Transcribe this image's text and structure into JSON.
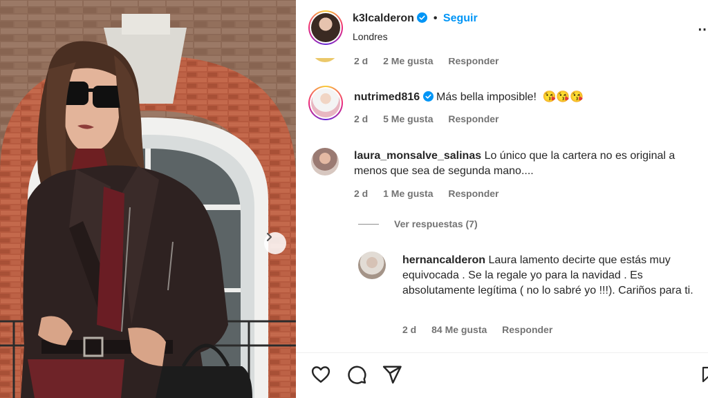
{
  "post": {
    "username": "k3lcalderon",
    "follow_label": "Seguir",
    "separator": "•",
    "location": "Londres",
    "more_label": "⋯"
  },
  "partial_comment": {
    "time": "2 d",
    "likes": "2 Me gusta",
    "reply": "Responder"
  },
  "comments": [
    {
      "username": "nutrimed816",
      "text": "Más bella imposible!",
      "emojis": "😘😘😘",
      "time": "2 d",
      "likes": "5 Me gusta",
      "reply": "Responder"
    },
    {
      "username": "laura_monsalve_salinas",
      "text": "Lo único que la cartera no es original a menos que sea de segunda mano....",
      "time": "2 d",
      "likes": "1 Me gusta",
      "reply": "Responder"
    }
  ],
  "view_replies_label": "Ver respuestas (7)",
  "reply": {
    "username": "hernancalderon",
    "text": "Laura lamento decirte que estás muy equivocada . Se la regale yo para la navidad . Es absolutamente legítima ( no lo sabré yo !!!). Cariños para ti.",
    "time": "2 d",
    "likes": "84 Me gusta",
    "reply": "Responder"
  },
  "icons": {
    "like": "heart-icon",
    "comment": "comment-icon",
    "share": "send-icon",
    "save": "bookmark-icon",
    "next": "chevron-right-icon",
    "verified": "verified-badge-icon"
  },
  "colors": {
    "follow": "#0095f6",
    "verified": "#0095f6",
    "meta": "#737373",
    "text": "#262626"
  }
}
